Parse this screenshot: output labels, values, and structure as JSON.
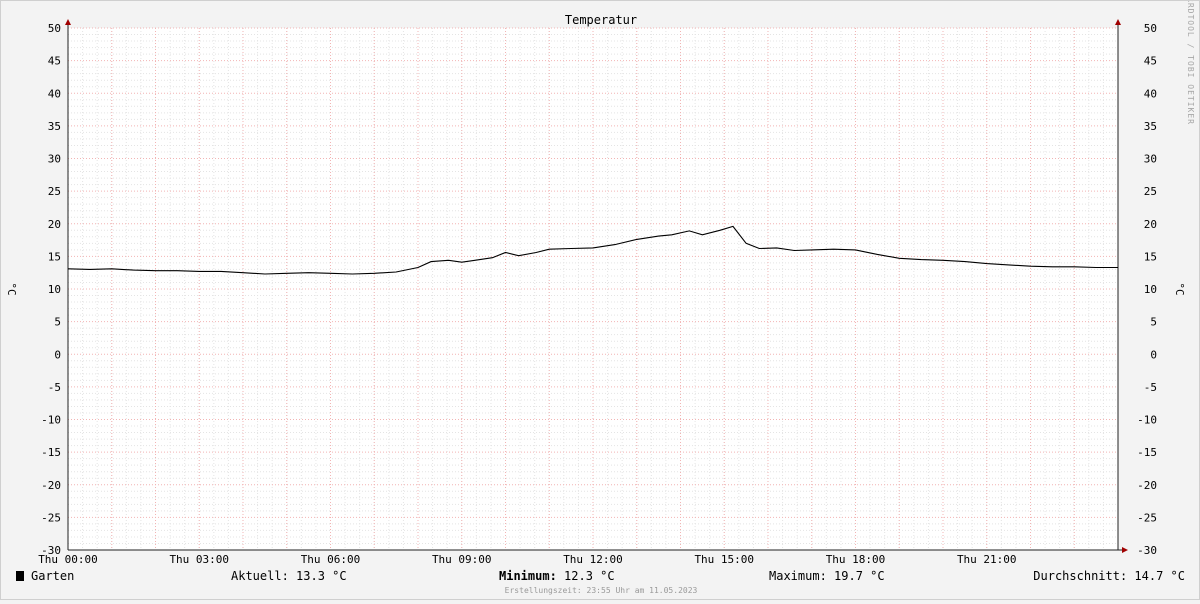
{
  "chart_data": {
    "type": "line",
    "title": "Temperatur",
    "ylabel_left": "°C",
    "ylabel_right": "°C",
    "ylim": [
      -30,
      50
    ],
    "yticks": [
      50,
      45,
      40,
      35,
      30,
      25,
      20,
      15,
      10,
      5,
      0,
      -5,
      -10,
      -15,
      -20,
      -25,
      -30
    ],
    "xlim_hours": [
      0,
      24
    ],
    "xticks": [
      {
        "hour": 0,
        "label": "Thu 00:00"
      },
      {
        "hour": 3,
        "label": "Thu 03:00"
      },
      {
        "hour": 6,
        "label": "Thu 06:00"
      },
      {
        "hour": 9,
        "label": "Thu 09:00"
      },
      {
        "hour": 12,
        "label": "Thu 12:00"
      },
      {
        "hour": 15,
        "label": "Thu 15:00"
      },
      {
        "hour": 18,
        "label": "Thu 18:00"
      },
      {
        "hour": 21,
        "label": "Thu 21:00"
      }
    ],
    "grid": true,
    "series": [
      {
        "name": "Garten",
        "color": "#000000",
        "points": [
          [
            0.0,
            13.1
          ],
          [
            0.5,
            13.0
          ],
          [
            1.0,
            13.1
          ],
          [
            1.5,
            12.9
          ],
          [
            2.0,
            12.8
          ],
          [
            2.5,
            12.8
          ],
          [
            3.0,
            12.7
          ],
          [
            3.5,
            12.7
          ],
          [
            4.0,
            12.5
          ],
          [
            4.5,
            12.3
          ],
          [
            5.0,
            12.4
          ],
          [
            5.5,
            12.5
          ],
          [
            6.0,
            12.4
          ],
          [
            6.5,
            12.3
          ],
          [
            7.0,
            12.4
          ],
          [
            7.5,
            12.6
          ],
          [
            8.0,
            13.3
          ],
          [
            8.3,
            14.2
          ],
          [
            8.7,
            14.4
          ],
          [
            9.0,
            14.1
          ],
          [
            9.3,
            14.4
          ],
          [
            9.7,
            14.8
          ],
          [
            10.0,
            15.6
          ],
          [
            10.3,
            15.1
          ],
          [
            10.7,
            15.6
          ],
          [
            11.0,
            16.1
          ],
          [
            11.5,
            16.2
          ],
          [
            12.0,
            16.3
          ],
          [
            12.5,
            16.8
          ],
          [
            13.0,
            17.6
          ],
          [
            13.5,
            18.1
          ],
          [
            13.8,
            18.3
          ],
          [
            14.2,
            18.9
          ],
          [
            14.5,
            18.3
          ],
          [
            14.9,
            19.0
          ],
          [
            15.2,
            19.6
          ],
          [
            15.5,
            17.0
          ],
          [
            15.8,
            16.2
          ],
          [
            16.2,
            16.3
          ],
          [
            16.6,
            15.9
          ],
          [
            17.0,
            16.0
          ],
          [
            17.5,
            16.1
          ],
          [
            18.0,
            16.0
          ],
          [
            18.5,
            15.3
          ],
          [
            19.0,
            14.7
          ],
          [
            19.5,
            14.5
          ],
          [
            20.0,
            14.4
          ],
          [
            20.5,
            14.2
          ],
          [
            21.0,
            13.9
          ],
          [
            21.5,
            13.7
          ],
          [
            22.0,
            13.5
          ],
          [
            22.5,
            13.4
          ],
          [
            23.0,
            13.4
          ],
          [
            23.5,
            13.3
          ],
          [
            24.0,
            13.3
          ]
        ]
      }
    ],
    "legend": {
      "series_label": "Garten",
      "aktuell": "Aktuell: 13.3 °C",
      "minimum_key": "Minimum:",
      "minimum_value": " 12.3 °C",
      "maximum": "Maximum: 19.7 °C",
      "durchschnitt": "Durchschnitt: 14.7 °C"
    },
    "footer": "Erstellungszeit: 23:55 Uhr am 11.05.2023",
    "watermark": "RRDTOOL / TOBI OETIKER"
  }
}
